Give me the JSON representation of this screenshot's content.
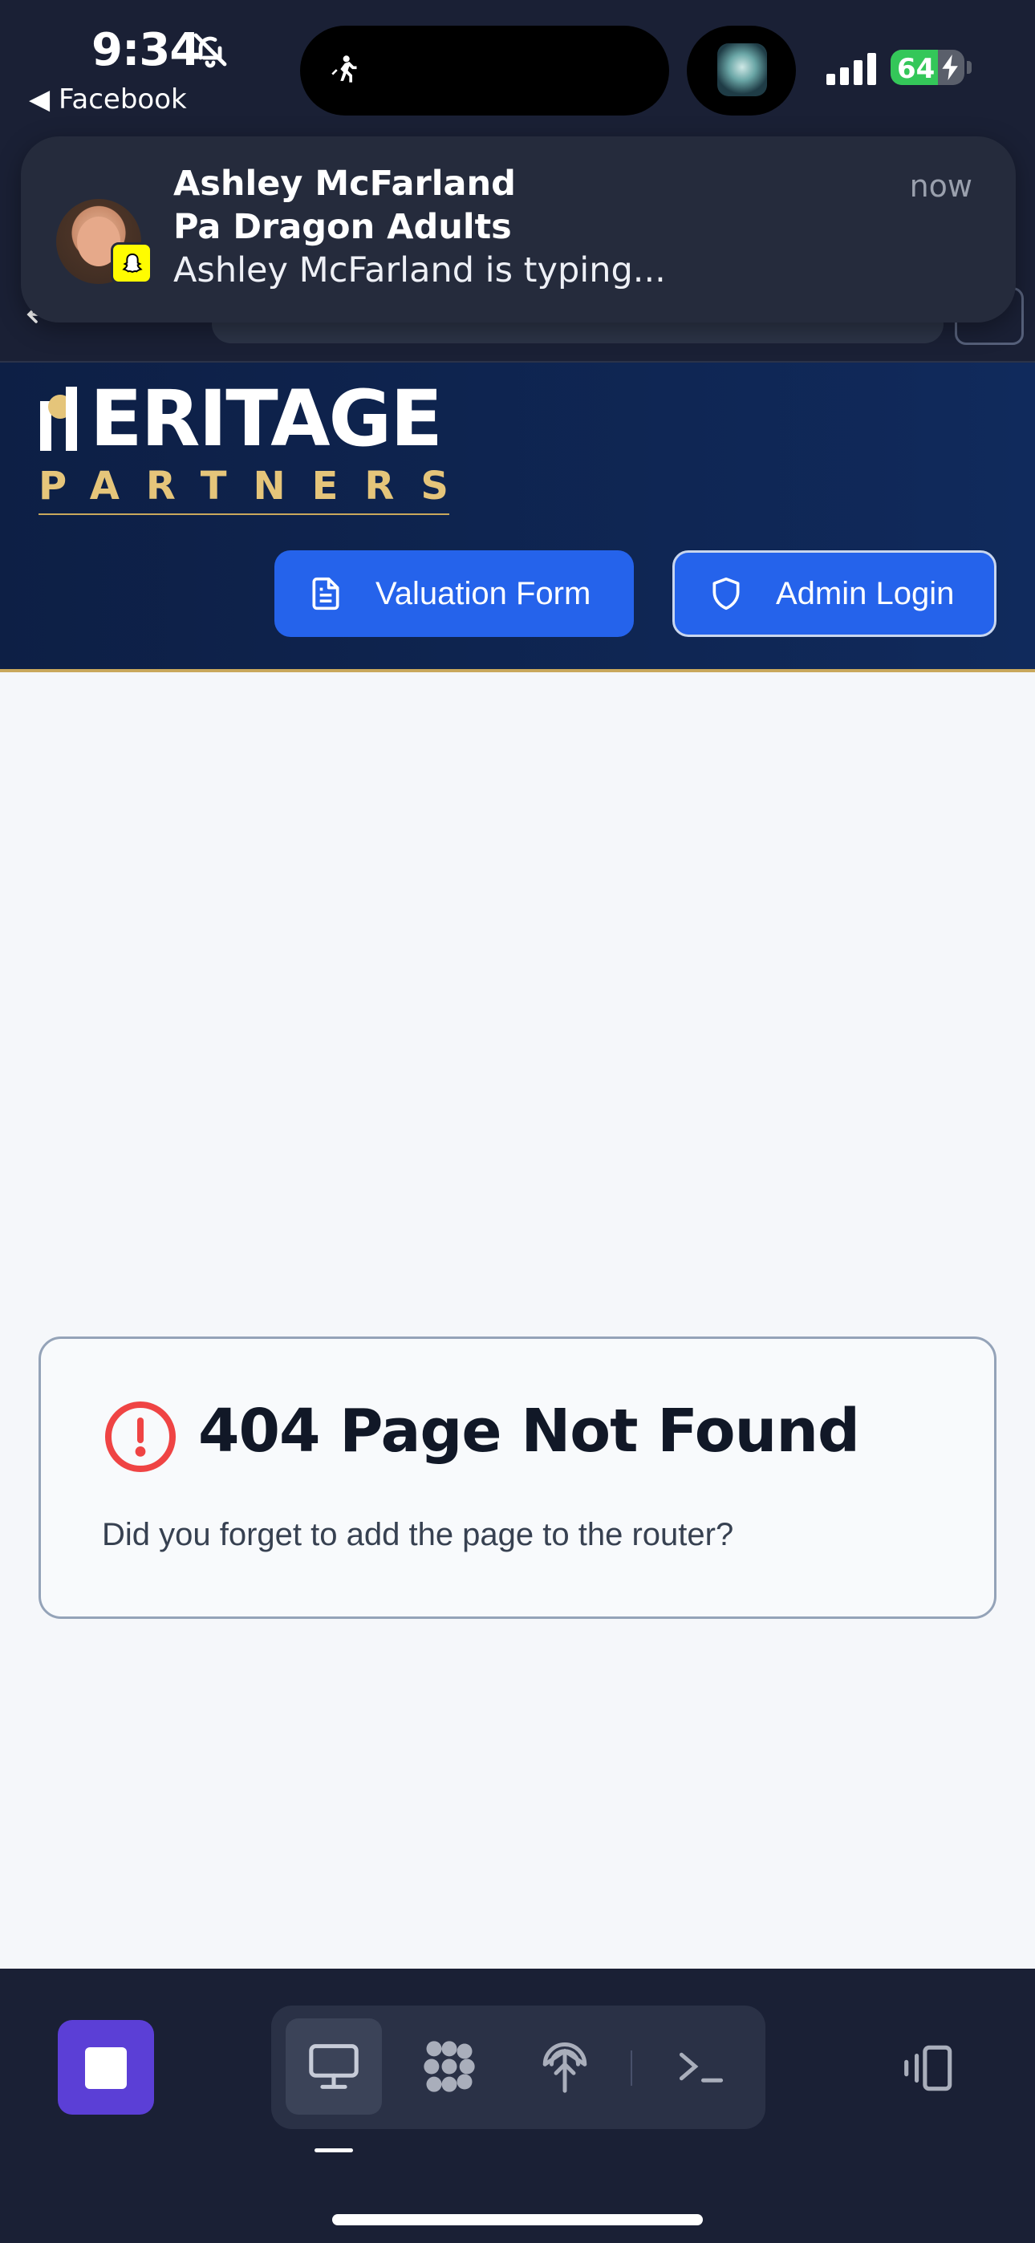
{
  "status_bar": {
    "time": "9:34",
    "back_app": "◀ Facebook",
    "battery_percent": "64",
    "battery_level": 0.64,
    "icons": [
      "bell-slash-icon",
      "walking-icon",
      "album-art",
      "signal-icon",
      "battery-icon",
      "bolt-icon"
    ]
  },
  "notification": {
    "title": "Ashley McFarland",
    "subtitle": "Pa Dragon Adults",
    "message": "Ashley McFarland is typing...",
    "time": "now",
    "app_icon": "snapchat-ghost-icon"
  },
  "site_header": {
    "logo_top": "ERITAGE",
    "logo_bottom": "PARTNERS",
    "valuation_button": "Valuation Form",
    "admin_button": "Admin Login",
    "colors": {
      "navy": "#0d1f45",
      "gold": "#e5c57a",
      "button_blue": "#2563eb"
    }
  },
  "error_card": {
    "title": "404 Page Not Found",
    "message": "Did you forget to add the page to the router?",
    "icon": "alert-circle-icon",
    "icon_color": "#ef4444"
  },
  "toolbar": {
    "items": [
      "stop-icon",
      "desktop-icon",
      "apps-grid-icon",
      "broadcast-icon",
      "terminal-icon",
      "rotate-device-icon"
    ],
    "active": "desktop-icon"
  }
}
